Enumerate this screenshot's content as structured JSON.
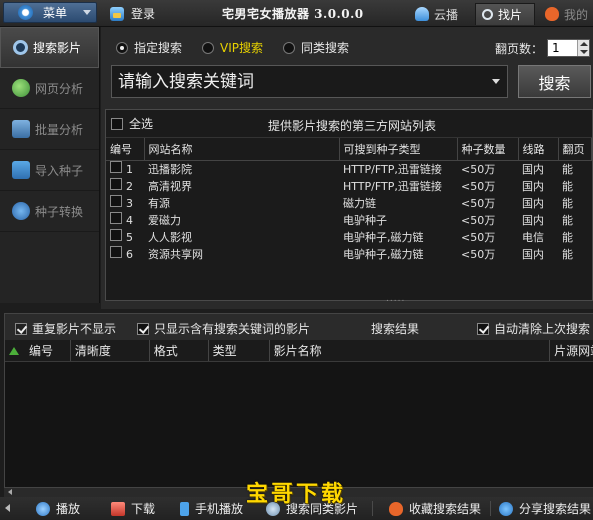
{
  "titlebar": {
    "menu_label": "菜单",
    "login_label": "登录",
    "app_title": "宅男宅女播放器 3.0.0.0",
    "tabs": [
      {
        "label": "云播"
      },
      {
        "label": "找片"
      },
      {
        "label": "我的"
      }
    ]
  },
  "sidebar": {
    "items": [
      {
        "label": "搜索影片",
        "icon": "search-icon"
      },
      {
        "label": "网页分析",
        "icon": "web-icon"
      },
      {
        "label": "批量分析",
        "icon": "batch-icon"
      },
      {
        "label": "导入种子",
        "icon": "import-icon"
      },
      {
        "label": "种子转换",
        "icon": "convert-icon"
      }
    ]
  },
  "search": {
    "modes": [
      {
        "label": "指定搜索",
        "selected": true
      },
      {
        "label": "VIP搜索",
        "selected": false
      },
      {
        "label": "同类搜索",
        "selected": false
      }
    ],
    "pages_label": "翻页数：",
    "pages_value": "1",
    "placeholder": "请输入搜索关键词",
    "button_label": "搜索"
  },
  "sites": {
    "select_all_label": "全选",
    "caption": "提供影片搜索的第三方网站列表",
    "columns": [
      "编号",
      "网站名称",
      "可搜到种子类型",
      "种子数量",
      "线路",
      "翻页"
    ],
    "rows": [
      {
        "no": "1",
        "name": "迅播影院",
        "type": "HTTP/FTP,迅雷链接",
        "count": "<50万",
        "line": "国内",
        "paging": "能"
      },
      {
        "no": "2",
        "name": "高清视界",
        "type": "HTTP/FTP,迅雷链接",
        "count": "<50万",
        "line": "国内",
        "paging": "能"
      },
      {
        "no": "3",
        "name": "有源",
        "type": "磁力链",
        "count": "<50万",
        "line": "国内",
        "paging": "能"
      },
      {
        "no": "4",
        "name": "爱磁力",
        "type": "电驴种子",
        "count": "<50万",
        "line": "国内",
        "paging": "能"
      },
      {
        "no": "5",
        "name": "人人影视",
        "type": "电驴种子,磁力链",
        "count": "<50万",
        "line": "电信",
        "paging": "能"
      },
      {
        "no": "6",
        "name": "资源共享网",
        "type": "电驴种子,磁力链",
        "count": "<50万",
        "line": "国内",
        "paging": "能"
      }
    ]
  },
  "results": {
    "opt_no_dup": "重复影片不显示",
    "opt_keyword_only": "只显示含有搜索关键词的影片",
    "title": "搜索结果",
    "opt_auto_clear": "自动清除上次搜索",
    "columns": [
      "编号",
      "清晰度",
      "格式",
      "类型",
      "影片名称",
      "片源网站"
    ]
  },
  "toolbar": {
    "play": "播放",
    "download": "下载",
    "phone_play": "手机播放",
    "similar_search": "搜索同类影片",
    "save_results": "收藏搜索结果",
    "share_results": "分享搜索结果"
  },
  "watermark": "宝哥下载"
}
